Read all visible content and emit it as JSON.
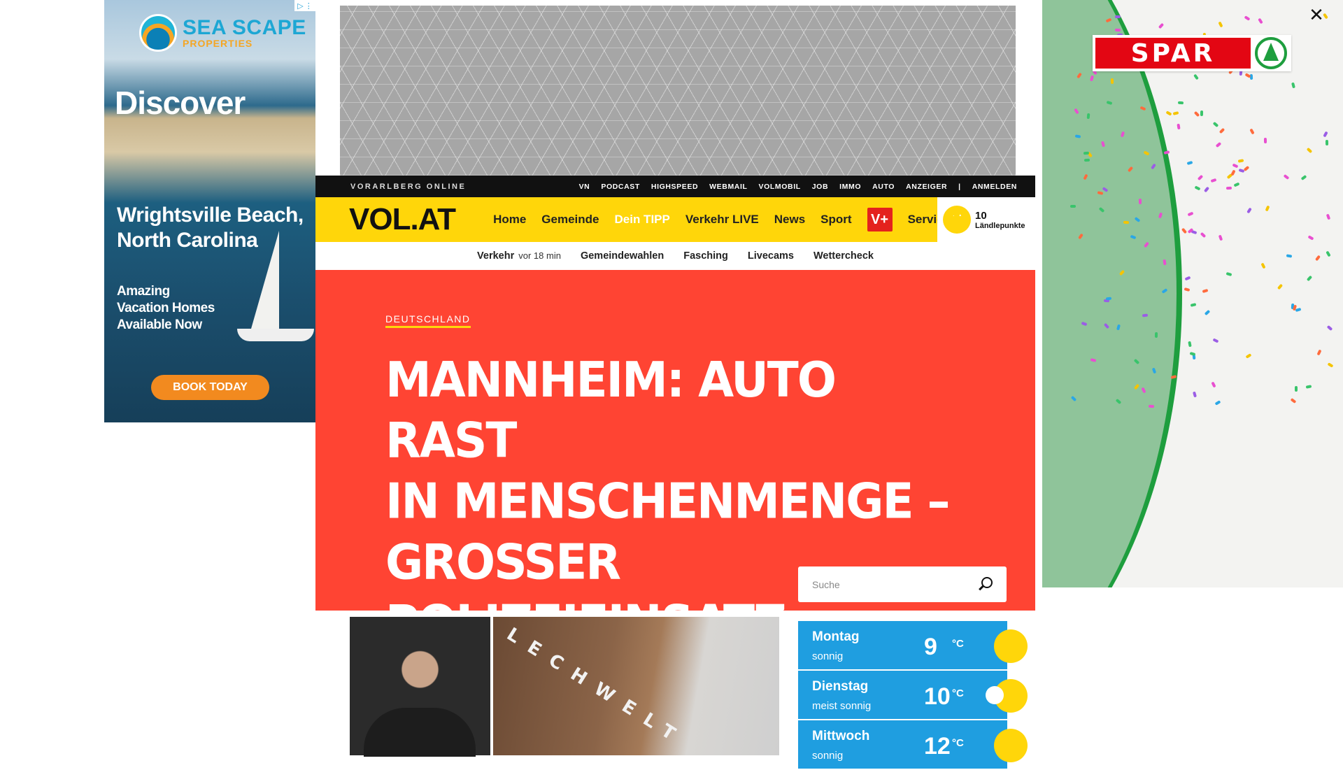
{
  "ad_left": {
    "brand_main": "SEA SCAPE",
    "brand_sub": "PROPERTIES",
    "headline": "Discover",
    "place_line1": "Wrightsville Beach,",
    "place_line2": "North Carolina",
    "tag_line1": "Amazing",
    "tag_line2": "Vacation Homes",
    "tag_line3": "Available Now",
    "cta": "BOOK TODAY",
    "adchoices_1": "▷",
    "adchoices_2": "⋮"
  },
  "ad_right": {
    "brand": "SPAR",
    "close_label": "✕"
  },
  "topbar": {
    "brand": "VORARLBERG ONLINE",
    "links": [
      "VN",
      "PODCAST",
      "HIGHSPEED",
      "WEBMAIL",
      "VOLMOBIL",
      "JOB",
      "IMMO",
      "AUTO",
      "ANZEIGER"
    ],
    "separator": "|",
    "login": "ANMELDEN"
  },
  "mainnav": {
    "logo": "VOL.AT",
    "items": [
      "Home",
      "Gemeinde",
      "Dein TIPP",
      "Verkehr LIVE",
      "News",
      "Sport"
    ],
    "vplus": "V+",
    "service": "Service",
    "points_value": "10",
    "points_label": "Ländlepunkte"
  },
  "subnav": {
    "traffic": "Verkehr",
    "traffic_time": "vor 18 min",
    "items": [
      "Gemeindewahlen",
      "Fasching",
      "Livecams",
      "Wettercheck"
    ]
  },
  "hero": {
    "category": "DEUTSCHLAND",
    "headline_line1": "MANNHEIM: AUTO RAST",
    "headline_line2": "IN MENSCHENMENGE –",
    "headline_line3": "GROSSER POLIZEIEINSATZ",
    "search_placeholder": "Suche"
  },
  "teasers": {
    "image2_text": "LECHWELT"
  },
  "weather": [
    {
      "day": "Montag",
      "desc": "sonnig",
      "temp": "9",
      "unit": "°C"
    },
    {
      "day": "Dienstag",
      "desc": "meist sonnig",
      "temp": "10",
      "unit": "°C"
    },
    {
      "day": "Mittwoch",
      "desc": "sonnig",
      "temp": "12",
      "unit": "°C"
    }
  ],
  "colors": {
    "accent_yellow": "#ffd60a",
    "hero_red": "#ff4433",
    "weather_blue": "#1f9ee0",
    "spar_red": "#e30613",
    "spar_green": "#1e9e3e"
  }
}
